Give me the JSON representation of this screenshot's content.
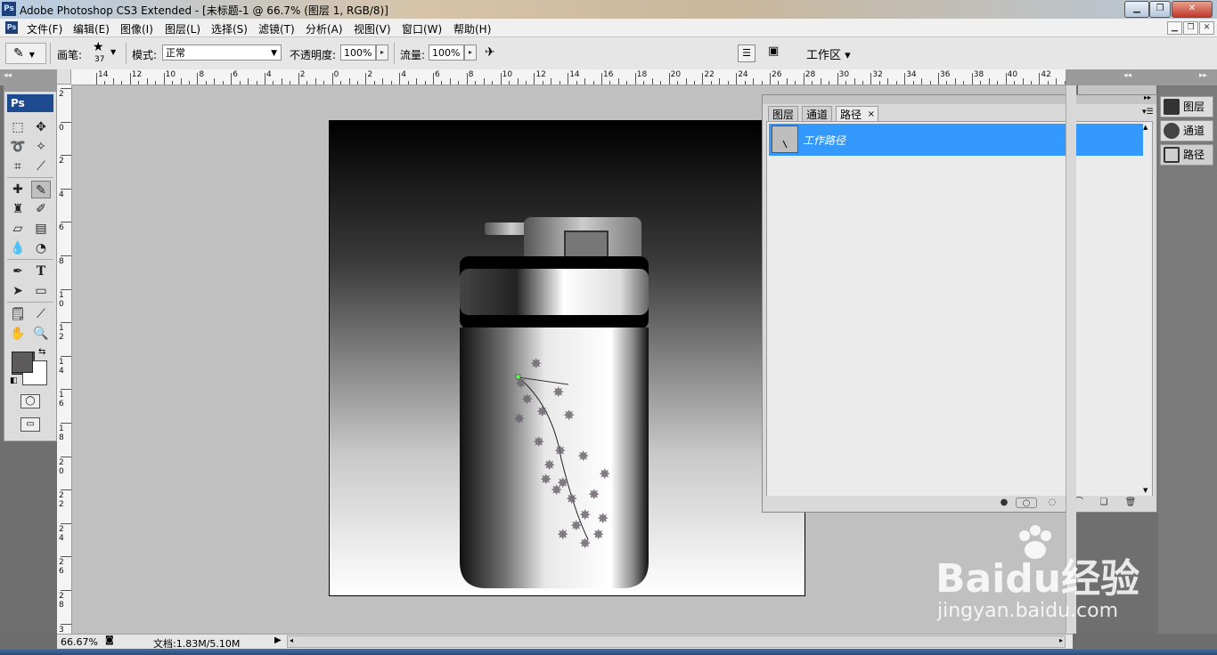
{
  "window": {
    "title": "Adobe Photoshop CS3 Extended - [未标题-1 @ 66.7% (图层 1, RGB/8)]",
    "app_icon": "Ps",
    "controls": [
      "minimize-icon",
      "maximize-icon",
      "close-icon"
    ]
  },
  "menu": {
    "items": [
      "文件(F)",
      "编辑(E)",
      "图像(I)",
      "图层(L)",
      "选择(S)",
      "滤镜(T)",
      "分析(A)",
      "视图(V)",
      "窗口(W)",
      "帮助(H)"
    ]
  },
  "options": {
    "brush_label": "画笔:",
    "brush_size": "37",
    "mode_label": "模式:",
    "mode_value": "正常",
    "opacity_label": "不透明度:",
    "opacity_value": "100%",
    "flow_label": "流量:",
    "flow_value": "100%",
    "workspace_label": "工作区 ▾"
  },
  "ruler": {
    "top_labels": [
      "14",
      "12",
      "10",
      "8",
      "6",
      "4",
      "2",
      "0",
      "2",
      "4",
      "6",
      "8",
      "10",
      "12",
      "14",
      "16",
      "18",
      "20",
      "22",
      "24",
      "26",
      "28",
      "30",
      "32",
      "34",
      "36",
      "38",
      "40",
      "42"
    ],
    "left_labels": [
      "2",
      "0",
      "2",
      "4",
      "6",
      "8",
      "1 0",
      "1 2",
      "1 4",
      "1 6",
      "1 8",
      "2 0",
      "2 2",
      "2 4",
      "2 6",
      "2 8",
      "3"
    ]
  },
  "toolbox": {
    "logo": "Ps"
  },
  "paths_panel": {
    "tabs": [
      "图层",
      "通道",
      "路径"
    ],
    "active_tab": "路径",
    "path_item": "工作路径"
  },
  "dock": {
    "items": [
      "图层",
      "通道",
      "路径"
    ]
  },
  "status": {
    "zoom": "66.67%",
    "doc_info": "文档:1.83M/5.10M"
  },
  "watermark": {
    "brand": "Baidu经验",
    "url": "jingyan.baidu.com"
  }
}
